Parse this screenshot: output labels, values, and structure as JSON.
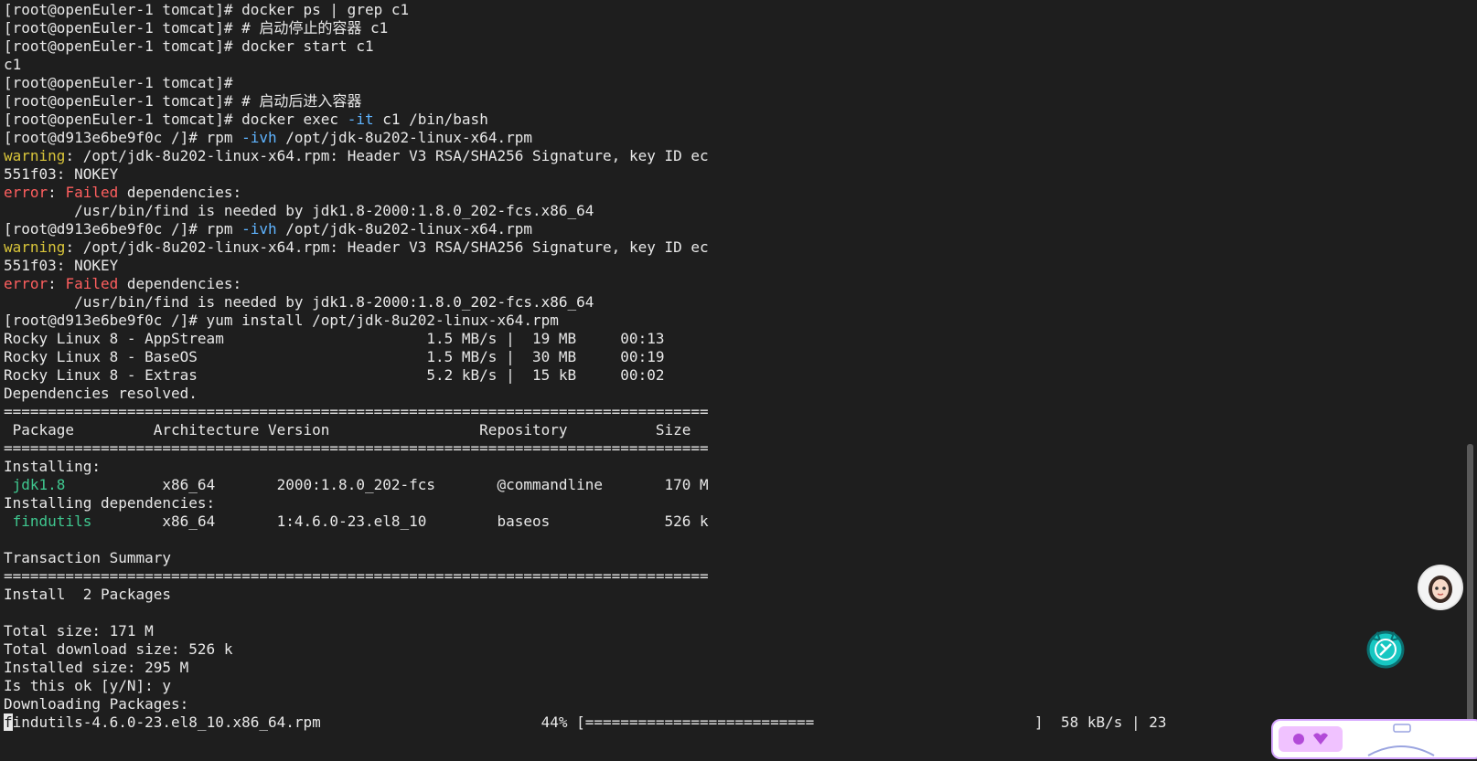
{
  "terminal": {
    "lines": [
      "[root@openEuler-1 tomcat]# docker ps | grep c1",
      "[root@openEuler-1 tomcat]# # 启动停止的容器 c1",
      "[root@openEuler-1 tomcat]# docker start c1",
      "c1",
      "[root@openEuler-1 tomcat]#",
      "[root@openEuler-1 tomcat]# # 启动后进入容器",
      {
        "parts": [
          {
            "t": "[root@openEuler-1 tomcat]# docker exec "
          },
          {
            "t": "-it",
            "c": "flag"
          },
          {
            "t": " c1 /bin/bash"
          }
        ]
      },
      {
        "parts": [
          {
            "t": "[root@d913e6be9f0c /]# rpm "
          },
          {
            "t": "-ivh",
            "c": "flag"
          },
          {
            "t": " /opt/jdk-8u202-linux-x64.rpm"
          }
        ]
      },
      {
        "parts": [
          {
            "t": "warning",
            "c": "warn"
          },
          {
            "t": ": /opt/jdk-8u202-linux-x64.rpm: Header V3 RSA/SHA256 Signature, key ID ec"
          }
        ]
      },
      "551f03: NOKEY",
      {
        "parts": [
          {
            "t": "error",
            "c": "err"
          },
          {
            "t": ": "
          },
          {
            "t": "Failed",
            "c": "err"
          },
          {
            "t": " dependencies:"
          }
        ]
      },
      "        /usr/bin/find is needed by jdk1.8-2000:1.8.0_202-fcs.x86_64",
      {
        "parts": [
          {
            "t": "[root@d913e6be9f0c /]# rpm "
          },
          {
            "t": "-ivh",
            "c": "flag"
          },
          {
            "t": " /opt/jdk-8u202-linux-x64.rpm"
          }
        ]
      },
      {
        "parts": [
          {
            "t": "warning",
            "c": "warn"
          },
          {
            "t": ": /opt/jdk-8u202-linux-x64.rpm: Header V3 RSA/SHA256 Signature, key ID ec"
          }
        ]
      },
      "551f03: NOKEY",
      {
        "parts": [
          {
            "t": "error",
            "c": "err"
          },
          {
            "t": ": "
          },
          {
            "t": "Failed",
            "c": "err"
          },
          {
            "t": " dependencies:"
          }
        ]
      },
      "        /usr/bin/find is needed by jdk1.8-2000:1.8.0_202-fcs.x86_64",
      "[root@d913e6be9f0c /]# yum install /opt/jdk-8u202-linux-x64.rpm",
      "Rocky Linux 8 - AppStream                       1.5 MB/s |  19 MB     00:13",
      "Rocky Linux 8 - BaseOS                          1.5 MB/s |  30 MB     00:19",
      "Rocky Linux 8 - Extras                          5.2 kB/s |  15 kB     00:02",
      "Dependencies resolved.",
      "================================================================================",
      " Package         Architecture Version                 Repository          Size",
      "================================================================================",
      "Installing:",
      {
        "parts": [
          {
            "t": " "
          },
          {
            "t": "jdk1.8",
            "c": "pkg"
          },
          {
            "t": "           x86_64       2000:1.8.0_202-fcs       @commandline       170 M"
          }
        ]
      },
      "Installing dependencies:",
      {
        "parts": [
          {
            "t": " "
          },
          {
            "t": "findutils",
            "c": "pkg"
          },
          {
            "t": "        x86_64       1:4.6.0-23.el8_10        baseos             526 k"
          }
        ]
      },
      "",
      "Transaction Summary",
      "================================================================================",
      "Install  2 Packages",
      "",
      "Total size: 171 M",
      "Total download size: 526 k",
      "Installed size: 295 M",
      "Is this ok [y/N]: y",
      "Downloading Packages:",
      {
        "parts": [
          {
            "t": "f",
            "c": "cursor"
          },
          {
            "t": "indutils-4.6.0-23.el8_10.x86_64.rpm                         44% [==========================                         ]  58 kB/s | 23"
          }
        ]
      }
    ]
  },
  "icons": {
    "avatar": "user-avatar-icon",
    "assistant": "assistant-robot-icon"
  }
}
